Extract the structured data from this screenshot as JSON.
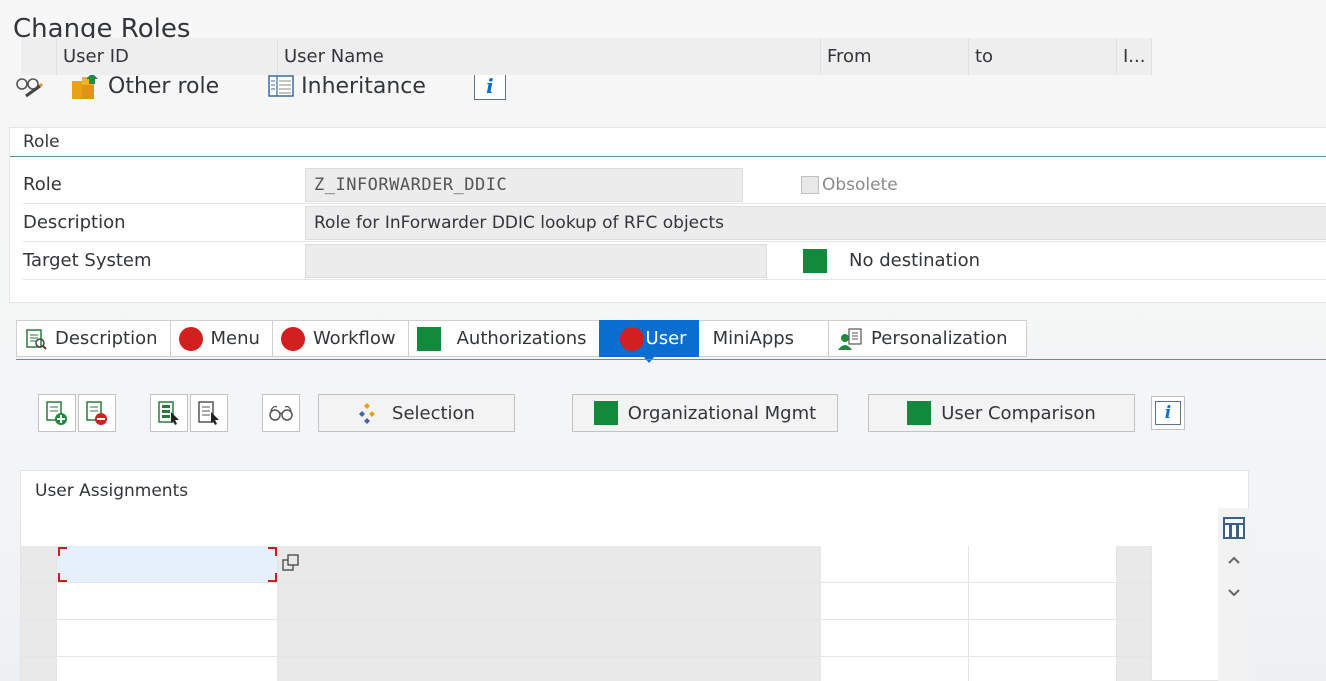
{
  "window": {
    "title": "Change Roles"
  },
  "toolbar": {
    "display_change_icon": "glasses-pencil-icon",
    "other_role_label": "Other role",
    "inheritance_label": "Inheritance",
    "info_label": "i"
  },
  "role_panel": {
    "header": "Role",
    "role_label": "Role",
    "role_value": "Z_INFORWARDER_DDIC",
    "obsolete_label": "Obsolete",
    "obsolete_checked": false,
    "description_label": "Description",
    "description_value": "Role for InForwarder DDIC lookup of RFC objects",
    "target_system_label": "Target System",
    "target_system_value": "",
    "destination_status": "No destination",
    "destination_color": "#118a3c"
  },
  "tabs": [
    {
      "label": "Description",
      "icon": "description-icon",
      "active": false
    },
    {
      "label": "Menu",
      "icon": "red-status-icon",
      "active": false
    },
    {
      "label": "Workflow",
      "icon": "red-status-icon",
      "active": false
    },
    {
      "label": "Authorizations",
      "icon": "green-status-icon",
      "active": false
    },
    {
      "label": "User",
      "icon": "red-status-icon",
      "active": true
    },
    {
      "label": "MiniApps",
      "icon": "",
      "active": false
    },
    {
      "label": "Personalization",
      "icon": "personalization-icon",
      "active": false
    }
  ],
  "actions": {
    "selection_label": "Selection",
    "org_mgmt_label": "Organizational Mgmt",
    "user_comparison_label": "User Comparison",
    "info_label": "i"
  },
  "table": {
    "title": "User Assignments",
    "columns": [
      "User ID",
      "User Name",
      "From",
      "to",
      "I..."
    ],
    "rows": [
      [
        "",
        "",
        "",
        "",
        ""
      ],
      [
        "",
        "",
        "",
        "",
        ""
      ],
      [
        "",
        "",
        "",
        "",
        ""
      ],
      [
        "",
        "",
        "",
        "",
        ""
      ]
    ]
  },
  "colors": {
    "accent": "#0a6ed1",
    "status_red": "#d21f1f",
    "status_green": "#118a3c"
  }
}
